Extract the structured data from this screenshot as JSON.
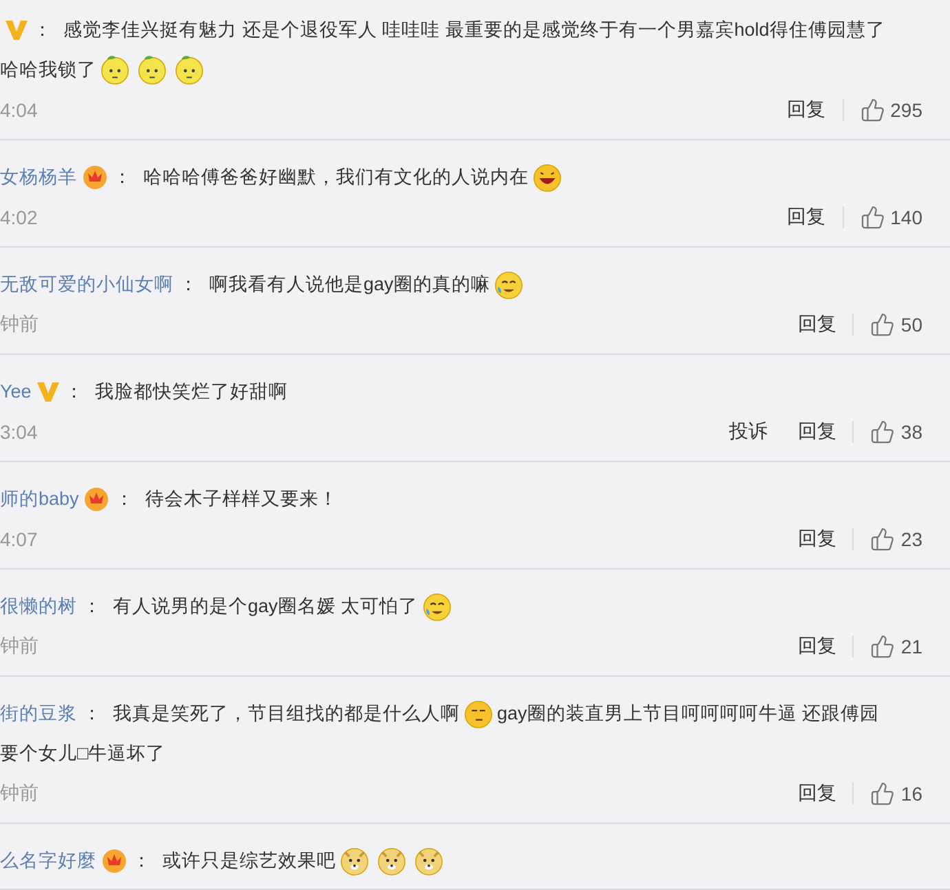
{
  "comments": [
    {
      "badge": {
        "kind": "v"
      },
      "separator": "：",
      "lines": [
        [
          {
            "kind": "text",
            "text": "感觉李佳兴挺有魅力 还是个退役军人 哇哇哇 最重要的是感觉终于有一个男嘉宾hold得住傅园慧了"
          }
        ],
        [
          {
            "kind": "text",
            "text": "哈哈我锁了"
          },
          {
            "kind": "lemon"
          },
          {
            "kind": "lemon"
          },
          {
            "kind": "lemon"
          }
        ]
      ],
      "time": "4:04",
      "actions": [
        "回复"
      ],
      "likes": "295"
    },
    {
      "name": "女杨杨羊",
      "badge": {
        "kind": "crown"
      },
      "separator": "：",
      "lines": [
        [
          {
            "kind": "text",
            "text": "哈哈哈傅爸爸好幽默，我们有文化的人说内在"
          },
          {
            "kind": "laugh"
          }
        ]
      ],
      "time": "4:02",
      "actions": [
        "回复"
      ],
      "likes": "140"
    },
    {
      "name": "无敌可爱的小仙女啊",
      "separator": "：",
      "lines": [
        [
          {
            "kind": "text",
            "text": "啊我看有人说他是gay圈的真的嘛"
          },
          {
            "kind": "cry"
          }
        ]
      ],
      "time": "钟前",
      "actions": [
        "回复"
      ],
      "likes": "50"
    },
    {
      "name": "Yee",
      "badge": {
        "kind": "v"
      },
      "separator": "：",
      "lines": [
        [
          {
            "kind": "text",
            "text": "我脸都快笑烂了好甜啊"
          }
        ]
      ],
      "time": "3:04",
      "actions": [
        "投诉",
        "回复"
      ],
      "likes": "38"
    },
    {
      "name": "师的baby",
      "badge": {
        "kind": "crown"
      },
      "separator": "：",
      "lines": [
        [
          {
            "kind": "text",
            "text": "待会木子样样又要来！"
          }
        ]
      ],
      "time": "4:07",
      "actions": [
        "回复"
      ],
      "likes": "23"
    },
    {
      "name": "很懒的树",
      "separator": "：",
      "lines": [
        [
          {
            "kind": "text",
            "text": "有人说男的是个gay圈名媛 太可怕了"
          },
          {
            "kind": "cry"
          }
        ]
      ],
      "time": "钟前",
      "actions": [
        "回复"
      ],
      "likes": "21"
    },
    {
      "name": "街的豆浆",
      "separator": "：",
      "lines": [
        [
          {
            "kind": "text",
            "text": "我真是笑死了，节目组找的都是什么人啊"
          },
          {
            "kind": "smirk"
          },
          {
            "kind": "text",
            "text": "gay圈的装直男上节目呵呵呵呵牛逼 还跟傅园"
          }
        ],
        [
          {
            "kind": "text",
            "text": "要个女儿□牛逼坏了"
          }
        ]
      ],
      "time": "钟前",
      "actions": [
        "回复"
      ],
      "likes": "16"
    },
    {
      "name": "么名字好麼",
      "badge": {
        "kind": "crown"
      },
      "separator": "：",
      "lines": [
        [
          {
            "kind": "text",
            "text": "或许只是综艺效果吧"
          },
          {
            "kind": "doge"
          },
          {
            "kind": "doge"
          },
          {
            "kind": "doge"
          }
        ]
      ]
    }
  ]
}
